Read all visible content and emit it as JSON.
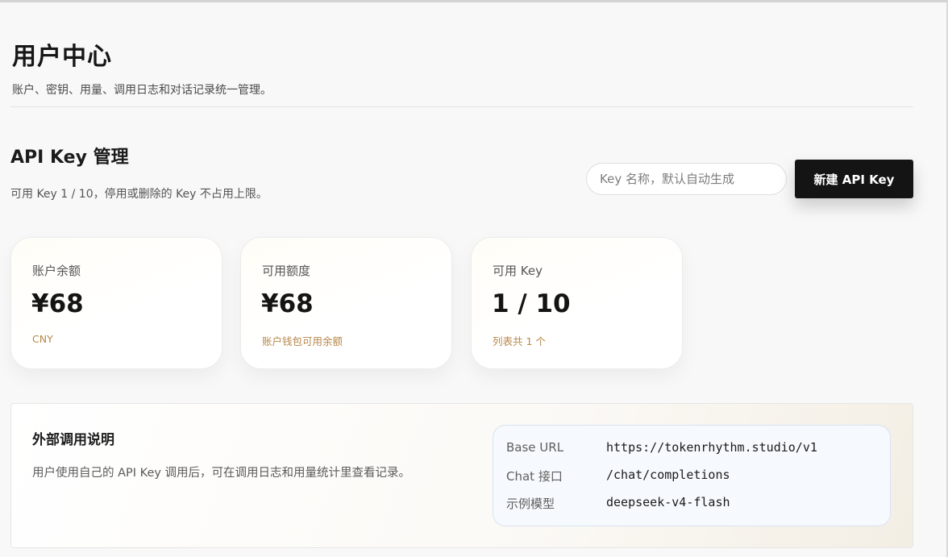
{
  "header": {
    "title": "用户中心",
    "subtitle": "账户、密钥、用量、调用日志和对话记录统一管理。"
  },
  "api_key_section": {
    "title": "API Key 管理",
    "description": "可用 Key 1 / 10，停用或删除的 Key 不占用上限。",
    "name_input_placeholder": "Key 名称，默认自动生成",
    "name_input_value": "",
    "create_button_label": "新建 API Key"
  },
  "stats": [
    {
      "label": "账户余额",
      "value": "¥68",
      "note": "CNY"
    },
    {
      "label": "可用额度",
      "value": "¥68",
      "note": "账户钱包可用余额"
    },
    {
      "label": "可用 Key",
      "value": "1 / 10",
      "note": "列表共 1 个"
    }
  ],
  "external_usage": {
    "title": "外部调用说明",
    "description": "用户使用自己的 API Key 调用后，可在调用日志和用量统计里查看记录。",
    "endpoints": [
      {
        "key": "Base URL",
        "value": "https://tokenrhythm.studio/v1"
      },
      {
        "key": "Chat 接口",
        "value": "/chat/completions"
      },
      {
        "key": "示例模型",
        "value": "deepseek-v4-flash"
      }
    ]
  },
  "colors": {
    "accent_note": "#b7874a",
    "button_bg": "#141414",
    "endpoint_bg": "#f6f9fd"
  }
}
